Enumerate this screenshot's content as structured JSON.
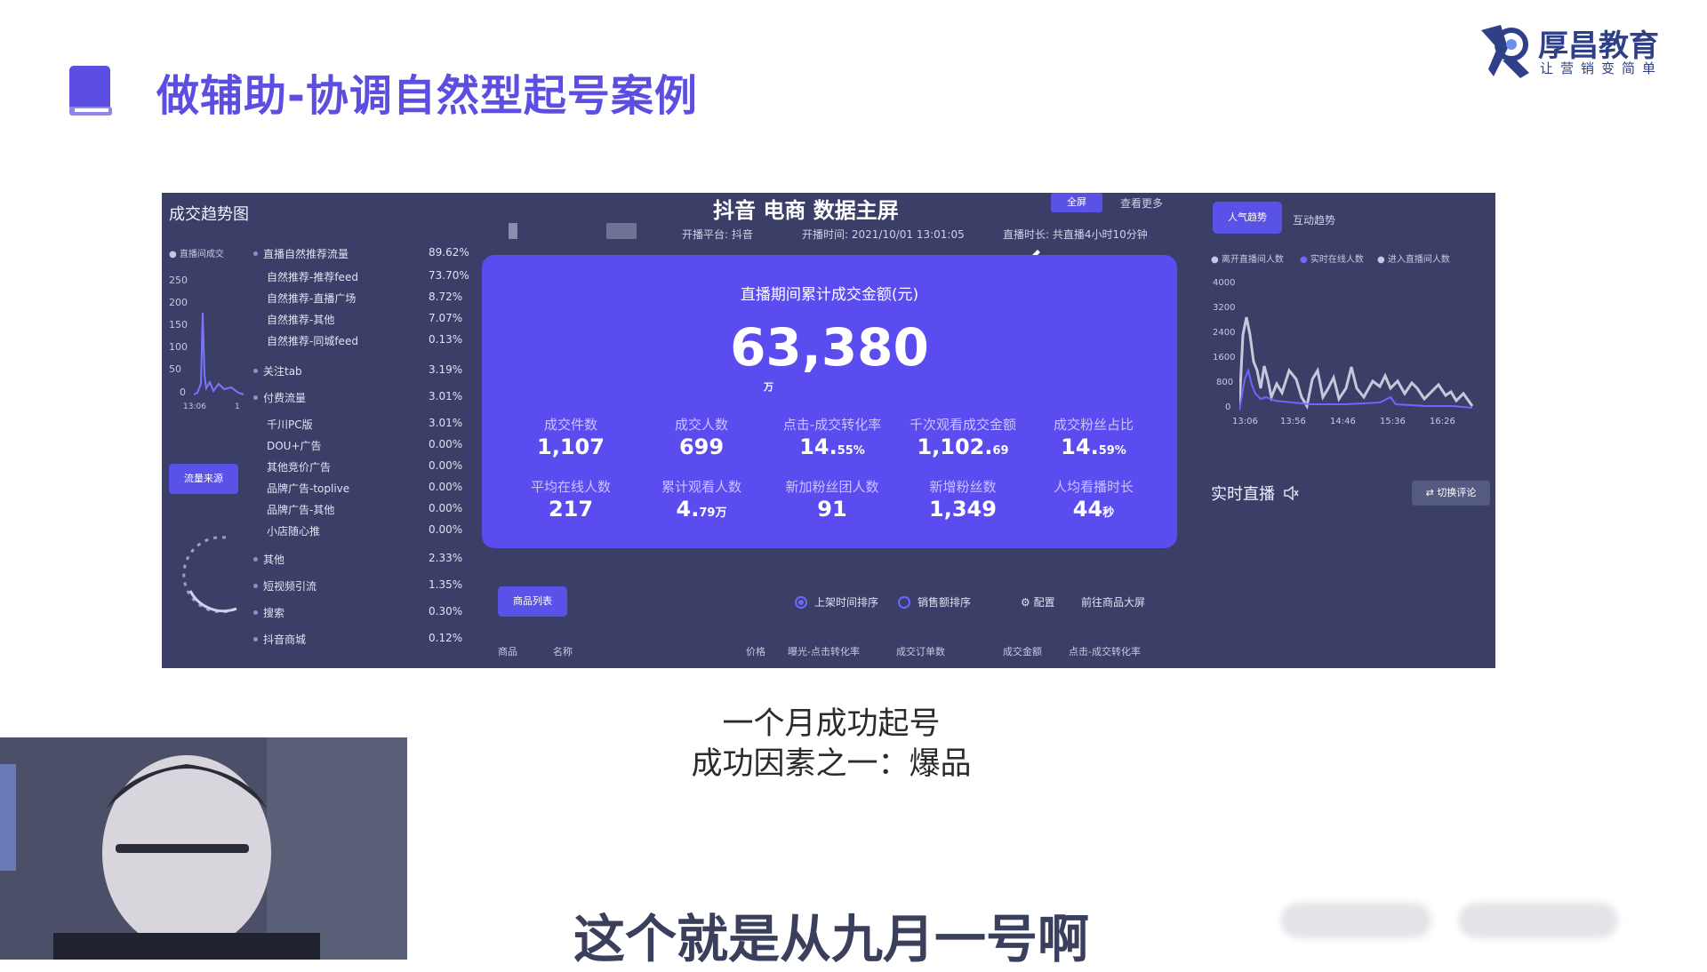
{
  "slide": {
    "title": "做辅助-协调自然型起号案例",
    "brand_name": "厚昌教育",
    "brand_slogan": "让营销变简单",
    "caption_line1": "一个月成功起号",
    "caption_line2": "成功因素之一：爆品",
    "subtitle": "这个就是从九月一号啊"
  },
  "dashboard": {
    "left": {
      "title": "成交趋势图",
      "legend": "直播间成交",
      "y_ticks": [
        "250",
        "200",
        "150",
        "100",
        "50",
        "0"
      ],
      "x_ticks": [
        "13:06",
        "1"
      ],
      "source_button": "流量来源",
      "flows": [
        {
          "label": "直播自然推荐流量",
          "pct": "89.62%"
        },
        {
          "label": "自然推荐-推荐feed",
          "pct": "73.70%"
        },
        {
          "label": "自然推荐-直播广场",
          "pct": "8.72%"
        },
        {
          "label": "自然推荐-其他",
          "pct": "7.07%"
        },
        {
          "label": "自然推荐-同城feed",
          "pct": "0.13%"
        },
        {
          "label": "关注tab",
          "pct": "3.19%"
        },
        {
          "label": "付费流量",
          "pct": "3.01%"
        },
        {
          "label": "千川PC版",
          "pct": "3.01%"
        },
        {
          "label": "DOU+广告",
          "pct": "0.00%"
        },
        {
          "label": "其他竞价广告",
          "pct": "0.00%"
        },
        {
          "label": "品牌广告-toplive",
          "pct": "0.00%"
        },
        {
          "label": "品牌广告-其他",
          "pct": "0.00%"
        },
        {
          "label": "小店随心推",
          "pct": "0.00%"
        },
        {
          "label": "其他",
          "pct": "2.33%"
        },
        {
          "label": "短视频引流",
          "pct": "1.35%"
        },
        {
          "label": "搜索",
          "pct": "0.30%"
        },
        {
          "label": "抖音商城",
          "pct": "0.12%"
        }
      ]
    },
    "header": {
      "logo": "抖音 电商 数据主屏",
      "fullscreen": "全屏",
      "more": "查看更多",
      "platform": "开播平台: 抖音",
      "start_time": "开播时间: 2021/10/01 13:01:05",
      "duration": "直播时长: 共直播4小时10分钟"
    },
    "card": {
      "label": "直播期间累计成交金额(元)",
      "amount": "63,380",
      "unit": "万",
      "stats": [
        {
          "label": "成交件数",
          "value": "1,107",
          "suffix": ""
        },
        {
          "label": "成交人数",
          "value": "699",
          "suffix": ""
        },
        {
          "label": "点击-成交转化率",
          "value": "14.",
          "suffix": "55%"
        },
        {
          "label": "千次观看成交金额",
          "value": "1,102.",
          "suffix": "69"
        },
        {
          "label": "成交粉丝占比",
          "value": "14.",
          "suffix": "59%"
        },
        {
          "label": "平均在线人数",
          "value": "217",
          "suffix": ""
        },
        {
          "label": "累计观看人数",
          "value": "4.",
          "suffix": "79万"
        },
        {
          "label": "新加粉丝团人数",
          "value": "91",
          "suffix": ""
        },
        {
          "label": "新增粉丝数",
          "value": "1,349",
          "suffix": ""
        },
        {
          "label": "人均看播时长",
          "value": "44",
          "suffix": "秒"
        }
      ]
    },
    "goods": {
      "button": "商品列表",
      "sort1": "上架时间排序",
      "sort2": "销售额排序",
      "config": "配置",
      "goto": "前往商品大屏",
      "columns": [
        "商品",
        "名称",
        "价格",
        "曝光-点击转化率",
        "成交订单数",
        "成交金额",
        "点击-成交转化率"
      ]
    },
    "right": {
      "tab_active": "人气趋势",
      "tab_inactive": "互动趋势",
      "legend": [
        "离开直播间人数",
        "实时在线人数",
        "进入直播间人数"
      ],
      "y_ticks": [
        "4000",
        "3200",
        "2400",
        "1600",
        "800",
        "0"
      ],
      "x_ticks": [
        "13:06",
        "13:56",
        "14:46",
        "15:36",
        "16:26"
      ],
      "live_title": "实时直播",
      "switch_button": "切换评论"
    }
  },
  "colors": {
    "title_purple": "#5b4ee0",
    "dashboard_bg": "#3b3f68",
    "card_purple": "#5b4cf0",
    "button_purple": "#5a52e6"
  }
}
